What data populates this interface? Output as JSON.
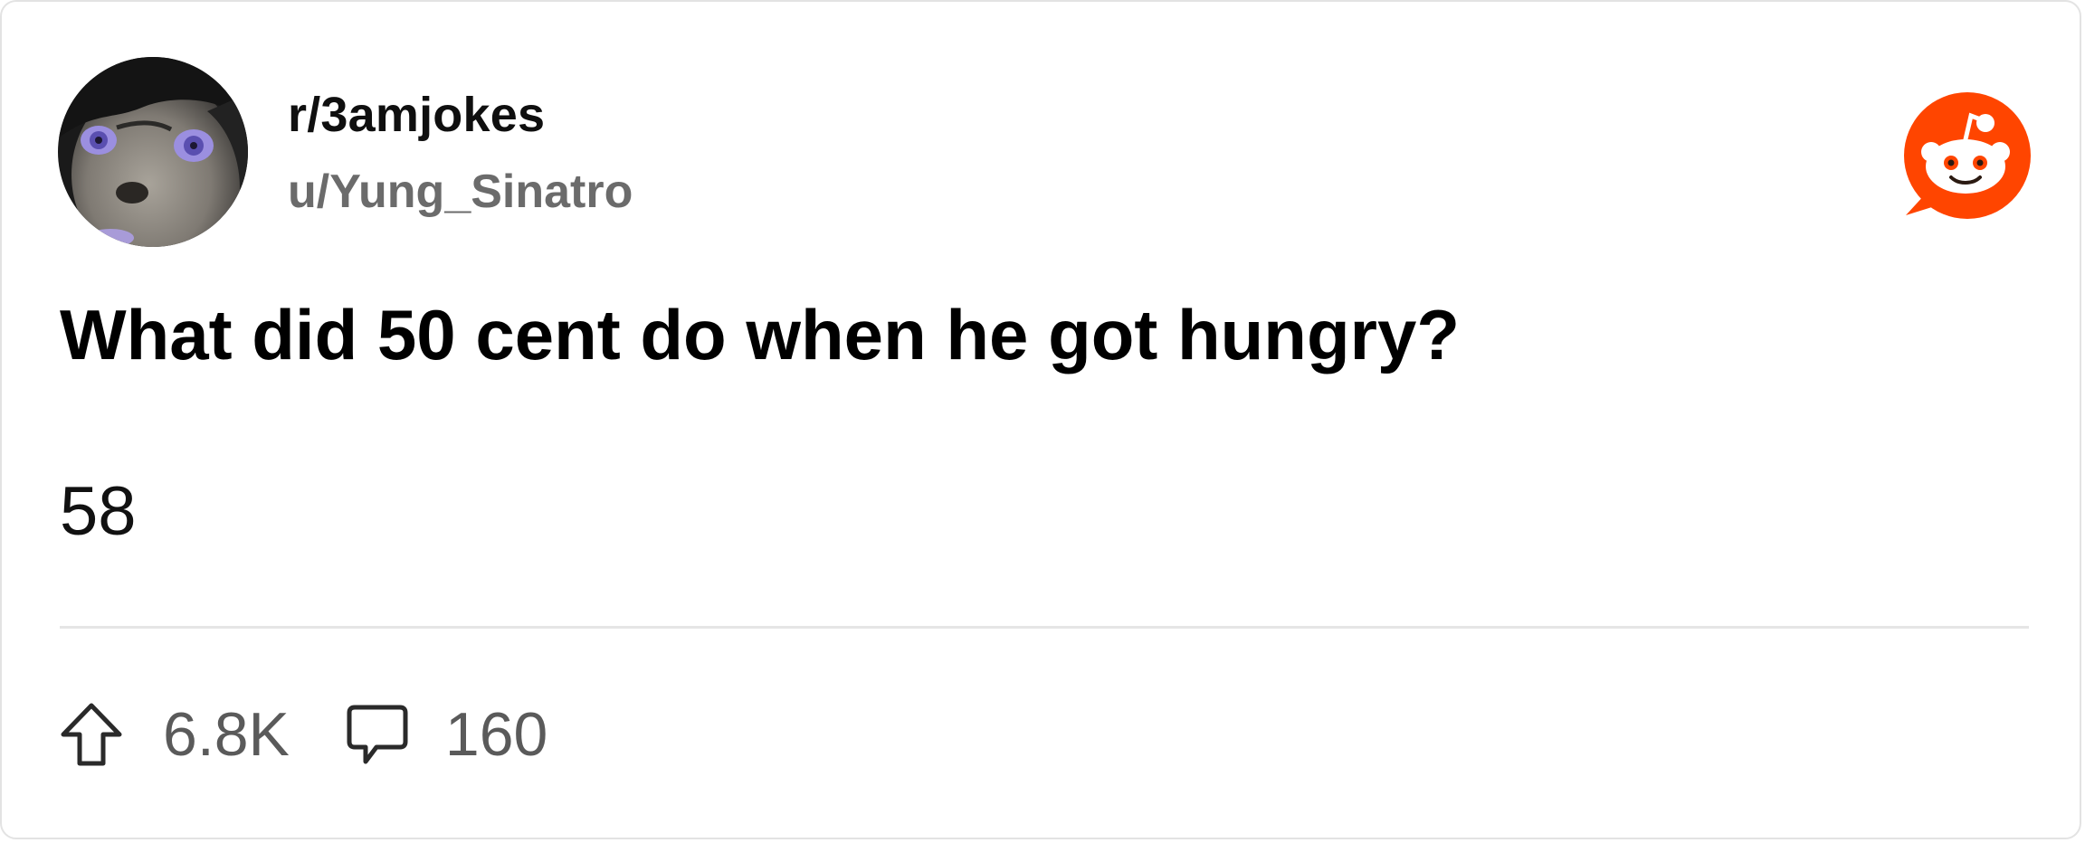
{
  "post": {
    "subreddit": "r/3amjokes",
    "author": "u/Yung_Sinatro",
    "title": "What did 50 cent do when he got hungry?",
    "body": "58",
    "upvotes": "6.8K",
    "comments": "160"
  },
  "icons": {
    "avatar": "user-avatar",
    "brand": "reddit-logo-icon",
    "upvote": "upvote-arrow-icon",
    "comment": "comment-bubble-icon"
  },
  "colors": {
    "brand": "#FF4500",
    "muted_text": "#6b6b6b",
    "divider": "#e5e5e5",
    "border": "#e3e3e3"
  }
}
